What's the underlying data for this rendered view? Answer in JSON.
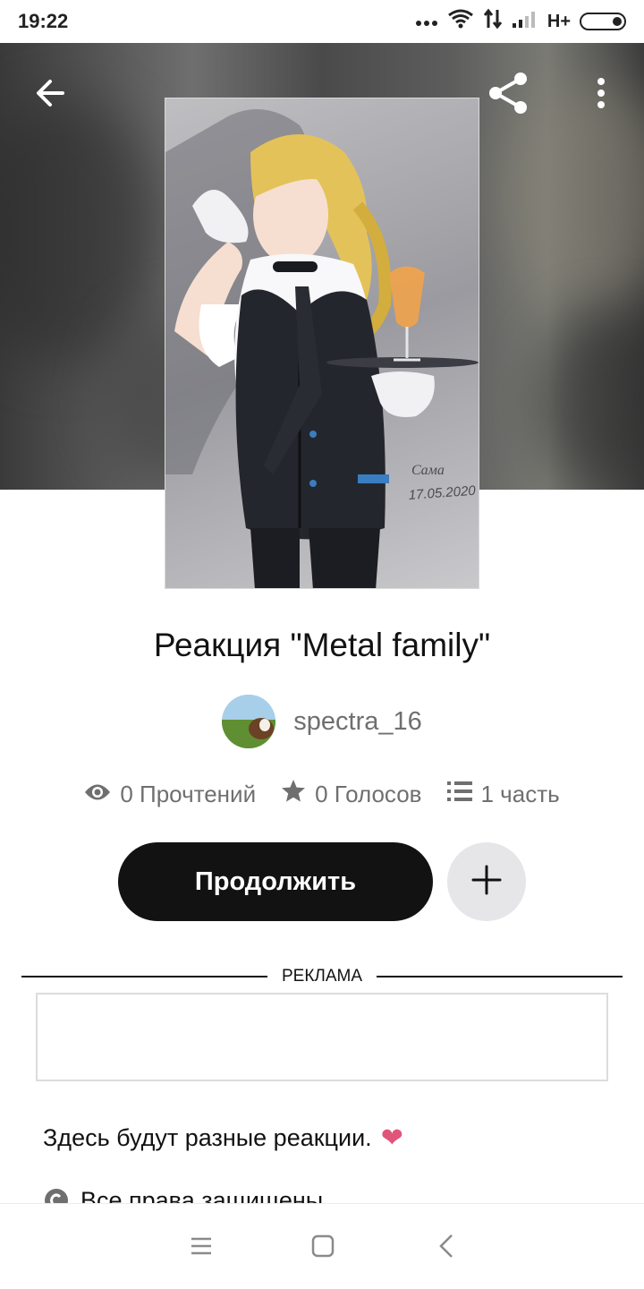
{
  "status_bar": {
    "time": "19:22",
    "network": "H+",
    "icons": [
      "more-dots-icon",
      "wifi-icon",
      "data-arrows-icon",
      "signal-icon",
      "battery-icon"
    ]
  },
  "header": {
    "icons": [
      "back-arrow-icon",
      "share-icon",
      "more-vertical-icon"
    ]
  },
  "cover": {
    "description_icon": "cover-art-image",
    "signature_date": "17.05.2020"
  },
  "story": {
    "title": "Реакция \"Metal family\"",
    "author": "spectra_16",
    "stats": {
      "reads": "0 Прочтений",
      "votes": "0 Голосов",
      "parts": "1 часть"
    },
    "continue_label": "Продолжить",
    "add_icon": "plus-icon"
  },
  "ad": {
    "label": "РЕКЛАМА"
  },
  "description": {
    "text": "Здесь будут разные реакции.",
    "emoji": "❤"
  },
  "rights": {
    "text": "Все права защищены"
  },
  "nav_bar": {
    "icons": [
      "menu-icon",
      "home-square-icon",
      "back-chevron-icon"
    ]
  },
  "colors": {
    "button_dark": "#121212",
    "add_button_bg": "#e6e5e8",
    "muted_text": "#6f6f6f",
    "heart": "#e0557a"
  }
}
